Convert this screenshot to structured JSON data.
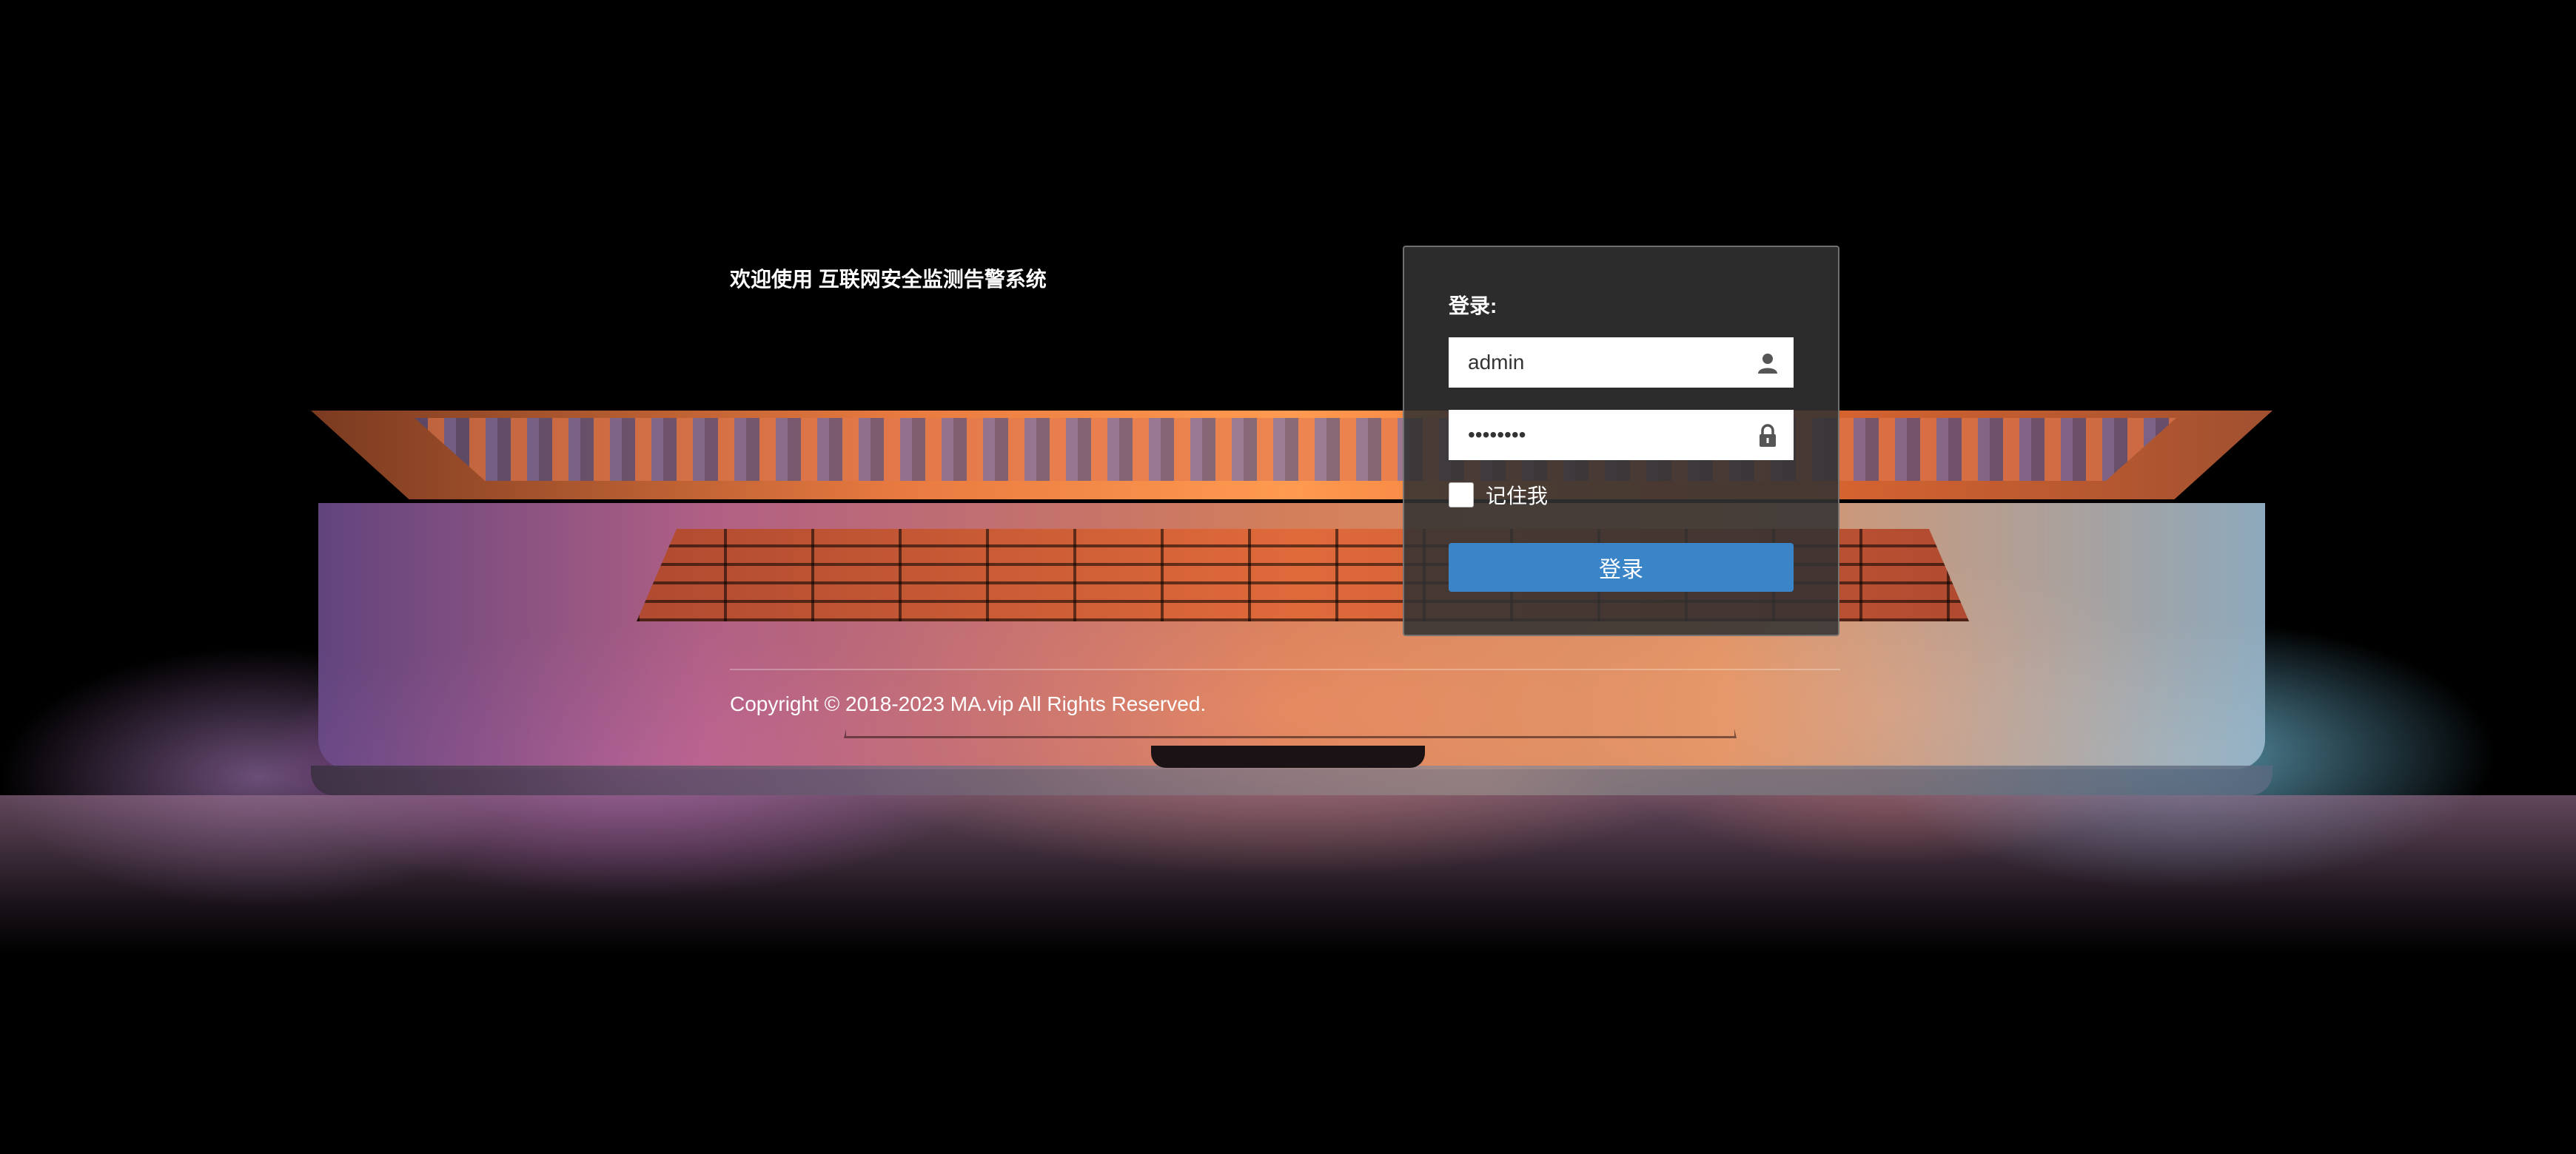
{
  "page": {
    "welcome_text": "欢迎使用 互联网安全监测告警系统",
    "copyright": "Copyright © 2018-2023 MA.vip All Rights Reserved."
  },
  "login": {
    "title": "登录:",
    "username": {
      "value": "admin",
      "icon": "user-icon"
    },
    "password": {
      "value": "••••••••",
      "icon": "lock-icon"
    },
    "remember_label": "记住我",
    "remember_checked": false,
    "submit_label": "登录",
    "accent_color": "#3a85c7"
  }
}
